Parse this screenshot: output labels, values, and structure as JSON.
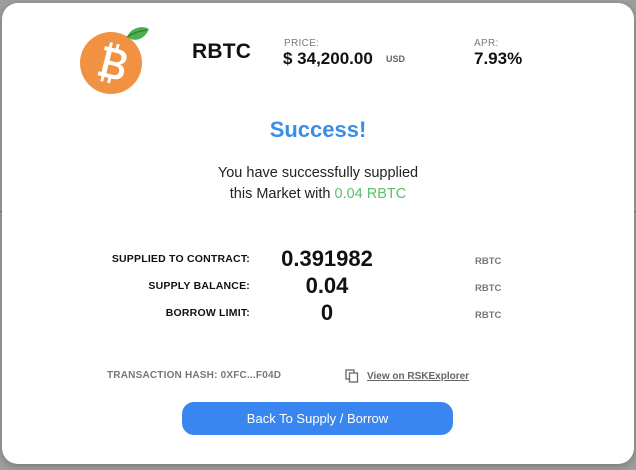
{
  "asset": {
    "icon": "bitcoin-orange-leaf-icon",
    "name": "RBTC",
    "price_label": "PRICE:",
    "price_value": "$ 34,200.00",
    "price_unit": "USD",
    "apr_label": "APR:",
    "apr_value": "7.93%"
  },
  "result": {
    "title": "Success!",
    "message_line1": "You have successfully supplied",
    "message_line2_prefix": "this Market with",
    "message_amount": "0.04 RBTC"
  },
  "stats": [
    {
      "label": "SUPPLIED TO CONTRACT:",
      "value": "0.391982",
      "unit": "RBTC"
    },
    {
      "label": "SUPPLY BALANCE:",
      "value": "0.04",
      "unit": "RBTC"
    },
    {
      "label": "BORROW LIMIT:",
      "value": "0",
      "unit": "RBTC"
    }
  ],
  "transaction": {
    "hash_text": "TRANSACTION HASH: 0XFC...F04D",
    "copy_icon": "copy-icon",
    "explorer_link": "View on RSKExplorer"
  },
  "actions": {
    "back_label": "Back To Supply / Borrow"
  },
  "colors": {
    "accent": "#3a8ee6",
    "success_amount": "#5cbf6a",
    "button": "#3a86f0",
    "logo_orange": "#f09242",
    "leaf_green": "#4caf50"
  }
}
